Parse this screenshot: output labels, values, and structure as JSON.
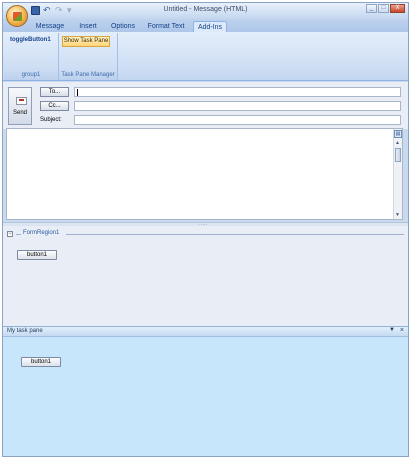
{
  "window": {
    "title": "Untitled - Message (HTML)",
    "controls": [
      "_",
      "□",
      "X"
    ]
  },
  "quick_access": {
    "undo_glyph": "↶",
    "redo_glyph": "↷",
    "more_glyph": "▾"
  },
  "tabs": [
    {
      "label": "Message"
    },
    {
      "label": "Insert"
    },
    {
      "label": "Options"
    },
    {
      "label": "Format Text"
    },
    {
      "label": "Add-Ins",
      "active": true
    }
  ],
  "ribbon": {
    "group1": {
      "button": "toggleButton1",
      "label": "group1"
    },
    "task_pane_manager": {
      "button": "Show Task Pane",
      "label": "Task Pane Manager"
    }
  },
  "message": {
    "send_label": "Send",
    "to_button": "To...",
    "cc_button": "Cc...",
    "subject_label": "Subject:",
    "to_value": "",
    "cc_value": "",
    "subject_value": ""
  },
  "form_region": {
    "title": "FormRegion1",
    "toggle_glyph": "−",
    "button": "button1"
  },
  "task_pane": {
    "title": "My task pane",
    "dropdown_glyph": "▼",
    "close_glyph": "×",
    "button": "button1"
  },
  "colors": {
    "accent": "#15428b",
    "ribbon_bg": "#dbe8f8",
    "task_pane_bg": "#c8e6fb",
    "highlight_button": "#ffd476"
  }
}
